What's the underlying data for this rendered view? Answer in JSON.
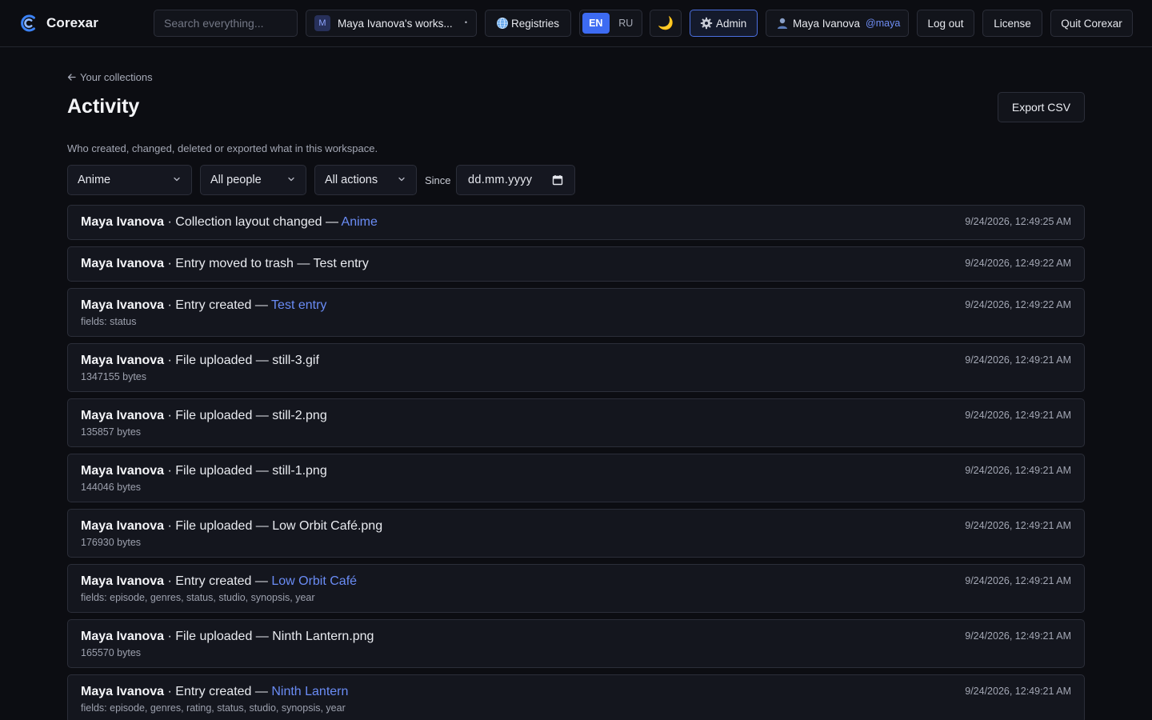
{
  "app": {
    "name": "Corexar",
    "search_placeholder": "Search everything...",
    "workspace": {
      "badge": "M",
      "name": "Maya Ivanova's works...",
      "caret": "•"
    },
    "registries_label": "Registries",
    "languages": [
      {
        "code": "EN",
        "active": true
      },
      {
        "code": "RU",
        "active": false
      }
    ],
    "theme_icon": "🌙",
    "admin_label": "Admin",
    "user": {
      "name": "Maya Ivanova",
      "handle": "@maya"
    },
    "logout_label": "Log out",
    "license_label": "License",
    "quit_label": "Quit Corexar",
    "colors": {
      "accent": "#3d6bf2",
      "link": "#6a8cf5",
      "background": "#0c0d12",
      "surface": "#14161e"
    }
  },
  "page": {
    "back_label": "Your collections",
    "title": "Activity",
    "export_label": "Export CSV",
    "subtitle": "Who created, changed, deleted or exported what in this workspace.",
    "filters": {
      "collection": "Anime",
      "people": "All people",
      "actions": "All actions",
      "since_label": "Since",
      "since_placeholder": "dd.mm.yyyy"
    }
  },
  "activity": [
    {
      "who": "Maya Ivanova",
      "action": "Collection layout changed",
      "target": "Anime",
      "target_is_link": true,
      "detail": "",
      "time": "9/24/2026, 12:49:25 AM"
    },
    {
      "who": "Maya Ivanova",
      "action": "Entry moved to trash",
      "target": "Test entry",
      "target_is_link": false,
      "detail": "",
      "time": "9/24/2026, 12:49:22 AM"
    },
    {
      "who": "Maya Ivanova",
      "action": "Entry created",
      "target": "Test entry",
      "target_is_link": true,
      "detail": "fields: status",
      "time": "9/24/2026, 12:49:22 AM"
    },
    {
      "who": "Maya Ivanova",
      "action": "File uploaded",
      "target": "still-3.gif",
      "target_is_link": false,
      "detail": "1347155 bytes",
      "time": "9/24/2026, 12:49:21 AM"
    },
    {
      "who": "Maya Ivanova",
      "action": "File uploaded",
      "target": "still-2.png",
      "target_is_link": false,
      "detail": "135857 bytes",
      "time": "9/24/2026, 12:49:21 AM"
    },
    {
      "who": "Maya Ivanova",
      "action": "File uploaded",
      "target": "still-1.png",
      "target_is_link": false,
      "detail": "144046 bytes",
      "time": "9/24/2026, 12:49:21 AM"
    },
    {
      "who": "Maya Ivanova",
      "action": "File uploaded",
      "target": "Low Orbit Café.png",
      "target_is_link": false,
      "detail": "176930 bytes",
      "time": "9/24/2026, 12:49:21 AM"
    },
    {
      "who": "Maya Ivanova",
      "action": "Entry created",
      "target": "Low Orbit Café",
      "target_is_link": true,
      "detail": "fields: episode, genres, status, studio, synopsis, year",
      "time": "9/24/2026, 12:49:21 AM"
    },
    {
      "who": "Maya Ivanova",
      "action": "File uploaded",
      "target": "Ninth Lantern.png",
      "target_is_link": false,
      "detail": "165570 bytes",
      "time": "9/24/2026, 12:49:21 AM"
    },
    {
      "who": "Maya Ivanova",
      "action": "Entry created",
      "target": "Ninth Lantern",
      "target_is_link": true,
      "detail": "fields: episode, genres, rating, status, studio, synopsis, year",
      "time": "9/24/2026, 12:49:21 AM"
    }
  ]
}
